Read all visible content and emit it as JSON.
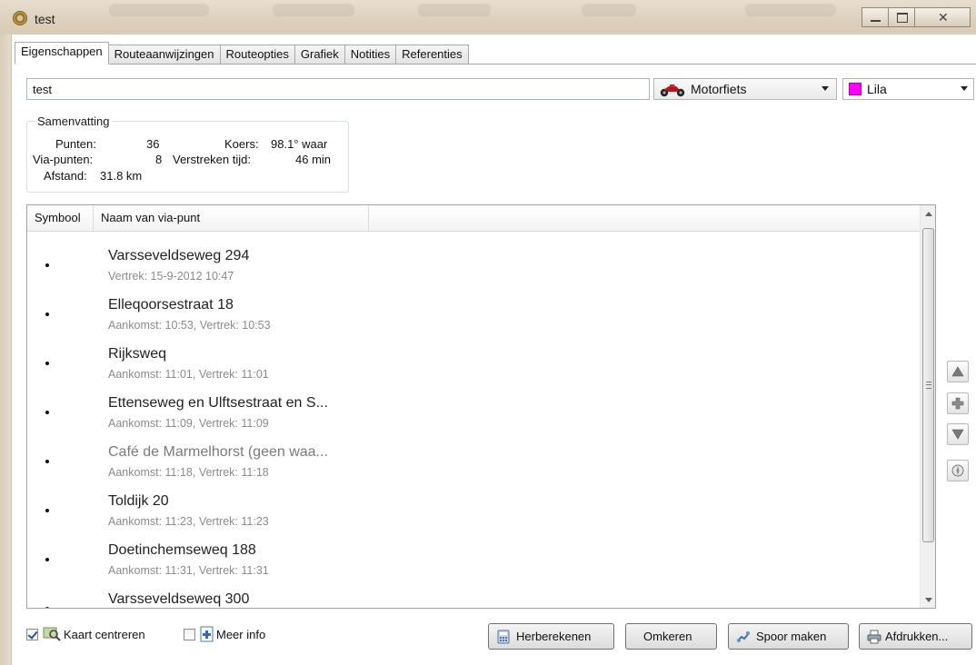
{
  "window": {
    "title": "test"
  },
  "tabs": [
    {
      "label": "Eigenschappen",
      "active": true
    },
    {
      "label": "Routeaanwijzingen",
      "active": false
    },
    {
      "label": "Routeopties",
      "active": false
    },
    {
      "label": "Grafiek",
      "active": false
    },
    {
      "label": "Notities",
      "active": false
    },
    {
      "label": "Referenties",
      "active": false
    }
  ],
  "route": {
    "name_value": "test",
    "transport_mode": "Motorfiets",
    "color_label": "Lila",
    "color_hex": "#ff00ff"
  },
  "summary": {
    "legend": "Samenvatting",
    "points_label": "Punten:",
    "points_value": "36",
    "via_label": "Via-punten:",
    "via_value": "8",
    "distance_label": "Afstand:",
    "distance_value": "31.8 km",
    "course_label": "Koers:",
    "course_value": "98.1° waar",
    "elapsed_label": "Verstreken tijd:",
    "elapsed_value": "46 min"
  },
  "list": {
    "columns": [
      "Symbool",
      "Naam van via-punt"
    ],
    "rows": [
      {
        "symbol": "dot",
        "name": "Varsseveldseweg 294",
        "time": "Vertrek: 15-9-2012 10:47",
        "dim": false
      },
      {
        "symbol": "dot",
        "name": "Elleqoorsestraat 18",
        "time": "Aankomst: 10:53, Vertrek: 10:53",
        "dim": false
      },
      {
        "symbol": "dot",
        "name": "Rijksweq",
        "time": "Aankomst: 11:01, Vertrek: 11:01",
        "dim": false
      },
      {
        "symbol": "dot",
        "name": "Ettenseweg en Ulftsestraat en S...",
        "time": "Aankomst: 11:09, Vertrek: 11:09",
        "dim": false
      },
      {
        "symbol": "dot",
        "name": "Café de Marmelhorst (geen waa...",
        "time": "Aankomst: 11:18, Vertrek: 11:18",
        "dim": true
      },
      {
        "symbol": "dot",
        "name": "Toldijk 20",
        "time": "Aankomst: 11:23, Vertrek: 11:23",
        "dim": false
      },
      {
        "symbol": "dot",
        "name": "Doetinchemseweq 188",
        "time": "Aankomst: 11:31, Vertrek: 11:31",
        "dim": false
      },
      {
        "symbol": "dot",
        "name": "Varsseveldseweq 300",
        "time": "",
        "dim": false
      }
    ]
  },
  "side_buttons": [
    "move-up-icon",
    "add-icon",
    "move-down-icon",
    "compass-icon"
  ],
  "bottom": {
    "center_map_label": "Kaart centreren",
    "center_map_checked": true,
    "more_info_label": "Meer info",
    "more_info_checked": false,
    "recalc_label": "Herberekenen",
    "reverse_label": "Omkeren",
    "make_track_label": "Spoor maken",
    "print_label": "Afdrukken..."
  }
}
